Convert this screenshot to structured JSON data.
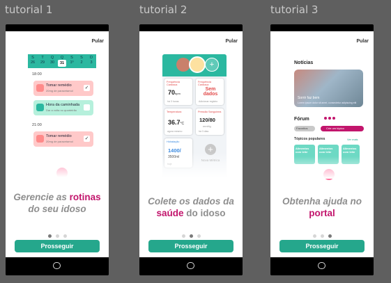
{
  "frames": [
    {
      "label": "tutorial 1",
      "skip": "Pular",
      "headline": {
        "p1": "Gerencie as ",
        "accent": "rotinas",
        "p2": "do seu idoso"
      },
      "button": "Prosseguir",
      "active_dot": 0,
      "calendar": {
        "weekdays": [
          "S",
          "T",
          "Q",
          "Q",
          "S",
          "S",
          "D"
        ],
        "days": [
          "26",
          "29",
          "30",
          "31",
          "1º",
          "2",
          "3"
        ]
      },
      "times": [
        "18:00",
        "21:00"
      ],
      "cards": [
        {
          "title": "Tomar remédio",
          "subtitle": "20mg de paracetamol"
        },
        {
          "title": "Hora da caminhada",
          "subtitle": "Dar a volta no quarteirão"
        },
        {
          "title": "Tomar remédio",
          "subtitle": "20mg de paracetamol"
        }
      ]
    },
    {
      "label": "tutorial 2",
      "skip": "Pular",
      "headline": {
        "p1": "Colete os dados da",
        "accent": "saúde",
        "p2": " do idoso"
      },
      "button": "Prosseguir",
      "active_dot": 1,
      "tiles": [
        {
          "label": "Frequência Cardíaca",
          "value": "70",
          "unit": "bpm",
          "note": "há 3 horas"
        },
        {
          "label": "Frequência Cardíaca",
          "value": "Sem dados",
          "unit": "",
          "note": "Adicionar registro"
        },
        {
          "label": "Temperatura",
          "value": "36.7",
          "unit": "°C",
          "note": "agora mesmo"
        },
        {
          "label": "Pressão Sanguínea",
          "value": "120/80",
          "unit": "mmHg",
          "note": "há 3 dias"
        },
        {
          "label": "Hidratação",
          "value": "1400/",
          "unit": "3500ml",
          "note": "hoje"
        }
      ],
      "new_metric": "Nova Métrica"
    },
    {
      "label": "tutorial 3",
      "skip": "Pular",
      "headline": {
        "p1": "Obtenha ajuda no",
        "accent": "portal",
        "p2": ""
      },
      "button": "Prosseguir",
      "active_dot": 2,
      "news_title": "Notícias",
      "news_caption": "Sorrir faz bem",
      "news_sub": "Lorem ipsum dolor sit amet, consectetur adipiscing elit",
      "forum_title": "Fórum",
      "forum_favorites": "Favoritos",
      "forum_create": "Crie um tópico",
      "topics_title": "Tópicos populares",
      "see_more": "Ver mais",
      "topics": [
        "Alimentos com leite",
        "Alimentos com leite",
        "Alimentos com leite"
      ]
    }
  ],
  "colors": {
    "primary": "#25a78c",
    "accent": "#c2156c",
    "teal": "#2bb8a0"
  }
}
